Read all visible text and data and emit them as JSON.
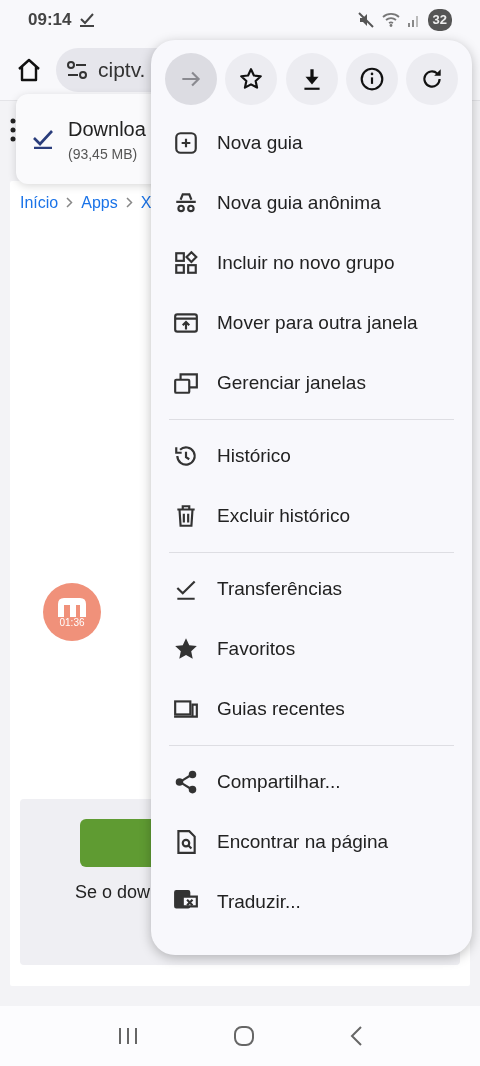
{
  "status_bar": {
    "time": "09:14",
    "battery": "32"
  },
  "toolbar": {
    "url": "ciptv."
  },
  "download_toast": {
    "title": "Downloa",
    "size": "(93,45 MB)"
  },
  "breadcrumb": [
    "Início",
    "Apps",
    "X"
  ],
  "recording_bubble": {
    "timer": "01:36"
  },
  "download_box": {
    "text": "Se o dow"
  },
  "menu": {
    "actions": [
      {
        "kind": "forward",
        "disabled": true
      },
      {
        "kind": "star",
        "disabled": false
      },
      {
        "kind": "download",
        "disabled": false
      },
      {
        "kind": "info",
        "disabled": false
      },
      {
        "kind": "reload",
        "disabled": false
      }
    ],
    "groups": [
      [
        {
          "kind": "new-tab",
          "label": "Nova guia"
        },
        {
          "kind": "incognito",
          "label": "Nova guia anônima"
        },
        {
          "kind": "group",
          "label": "Incluir no novo grupo"
        },
        {
          "kind": "move",
          "label": "Mover para outra janela"
        },
        {
          "kind": "windows",
          "label": "Gerenciar janelas"
        }
      ],
      [
        {
          "kind": "history",
          "label": "Histórico"
        },
        {
          "kind": "trash",
          "label": "Excluir histórico"
        }
      ],
      [
        {
          "kind": "downloads",
          "label": "Transferências"
        },
        {
          "kind": "bookmarks",
          "label": "Favoritos"
        },
        {
          "kind": "devices",
          "label": "Guias recentes"
        }
      ],
      [
        {
          "kind": "share",
          "label": "Compartilhar..."
        },
        {
          "kind": "find",
          "label": "Encontrar na página"
        },
        {
          "kind": "translate",
          "label": "Traduzir..."
        }
      ]
    ]
  }
}
